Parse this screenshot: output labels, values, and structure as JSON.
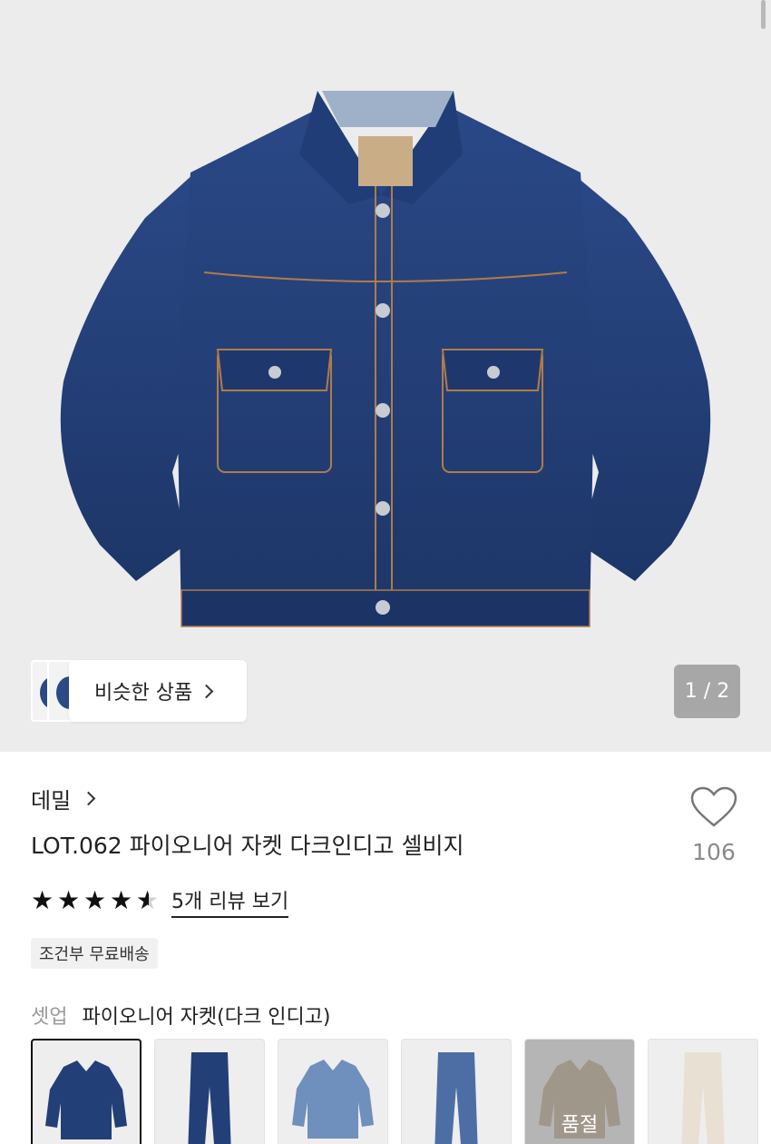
{
  "gallery": {
    "counter": "1 / 2",
    "similar_label": "비슷한 상품"
  },
  "product": {
    "brand": "데밀",
    "title": "LOT.062 파이오니어 자켓 다크인디고 셀비지",
    "like_count": "106",
    "rating": 4.5,
    "review_link": "5개 리뷰 보기",
    "shipping_badge": "조건부 무료배송"
  },
  "setup": {
    "label": "셋업",
    "name": "파이오니어 자켓(다크 인디고)",
    "soldout_label": "품절",
    "items": [
      {
        "kind": "jacket-dark",
        "selected": true,
        "soldout": false
      },
      {
        "kind": "pants-dark",
        "selected": false,
        "soldout": false
      },
      {
        "kind": "jacket-light",
        "selected": false,
        "soldout": false
      },
      {
        "kind": "pants-mid",
        "selected": false,
        "soldout": false
      },
      {
        "kind": "jacket-beige",
        "selected": false,
        "soldout": true
      },
      {
        "kind": "pants-cream",
        "selected": false,
        "soldout": false
      }
    ]
  },
  "colors": {
    "denim_dark": "#233f78",
    "denim_light": "#6f8fbd",
    "beige": "#c9b9a3",
    "cream": "#e8e0d2"
  },
  "icons": [
    "heart-icon",
    "chevron-right-icon",
    "star-icon"
  ]
}
